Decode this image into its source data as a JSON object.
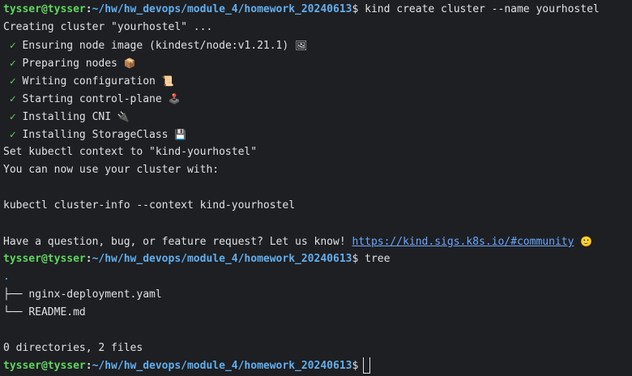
{
  "prompt": {
    "user": "tysser@tysser",
    "colon": ":",
    "path": "~/hw/hw_devops/module_4/homework_20240613",
    "symbol": "$"
  },
  "commands": {
    "create": "kind create cluster --name yourhostel",
    "tree": "tree"
  },
  "output": {
    "creating": "Creating cluster \"yourhostel\" ...",
    "check": "✓",
    "steps": [
      {
        "text": "Ensuring node image (kindest/node:v1.21.1)",
        "emoji": "🖼"
      },
      {
        "text": "Preparing nodes",
        "emoji": "📦"
      },
      {
        "text": "Writing configuration",
        "emoji": "📜"
      },
      {
        "text": "Starting control-plane",
        "emoji": "🕹️"
      },
      {
        "text": "Installing CNI",
        "emoji": "🔌"
      },
      {
        "text": "Installing StorageClass",
        "emoji": "💾"
      }
    ],
    "context_set": "Set kubectl context to \"kind-yourhostel\"",
    "use_cluster": "You can now use your cluster with:",
    "cluster_info": "kubectl cluster-info --context kind-yourhostel",
    "question": "Have a question, bug, or feature request? Let us know!",
    "community_link": "https://kind.sigs.k8s.io/#community",
    "smile": "🙂"
  },
  "tree": {
    "root": ".",
    "entries": [
      {
        "branch": "├── ",
        "name": "nginx-deployment.yaml"
      },
      {
        "branch": "└── ",
        "name": "README.md"
      }
    ],
    "summary": "0 directories, 2 files"
  }
}
